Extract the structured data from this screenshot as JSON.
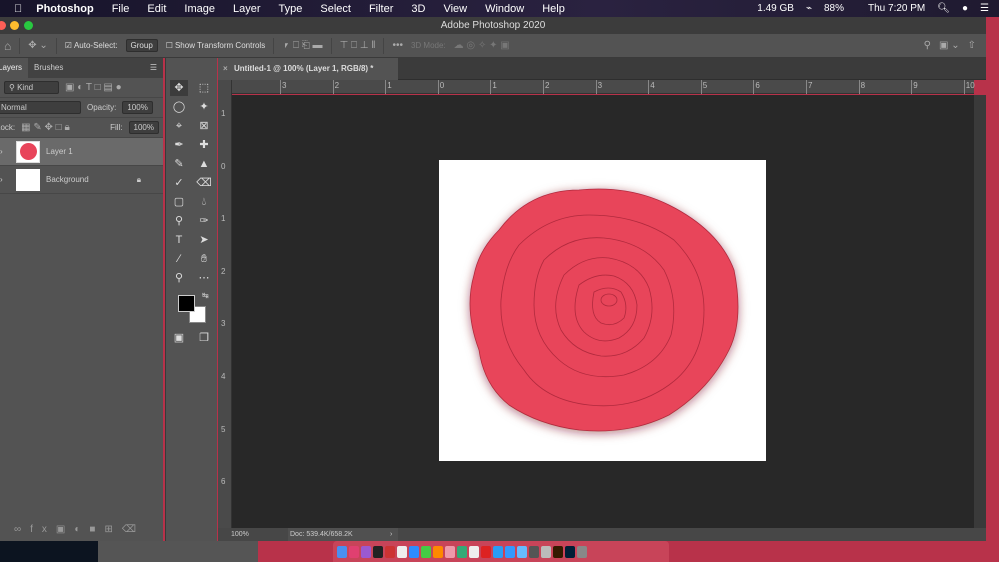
{
  "menubar": {
    "app": "Photoshop",
    "items": [
      "File",
      "Edit",
      "Image",
      "Layer",
      "Type",
      "Select",
      "Filter",
      "3D",
      "View",
      "Window",
      "Help"
    ],
    "status": {
      "memory": "1.49 GB",
      "battery": "88%",
      "clock": "Thu 7:20 PM"
    }
  },
  "window": {
    "title": "Adobe Photoshop 2020"
  },
  "options": {
    "auto_select_label": "Auto-Select:",
    "auto_select_checked": true,
    "group_value": "Group",
    "show_transform_label": "Show Transform Controls",
    "show_transform_checked": false,
    "mode_3d_label": "3D Mode:"
  },
  "layers_panel": {
    "tabs": [
      "Layers",
      "Brushes"
    ],
    "filter_kind": "Kind",
    "blend_mode": "Normal",
    "opacity_label": "Opacity:",
    "opacity_value": "100%",
    "lock_label": "Lock:",
    "fill_label": "Fill:",
    "fill_value": "100%",
    "layers": [
      {
        "name": "Layer 1",
        "selected": true
      },
      {
        "name": "Background",
        "locked": true
      }
    ]
  },
  "document": {
    "tab_title": "Untitled-1 @ 100% (Layer 1, RGB/8) *",
    "zoom": "100%",
    "doc_info": "Doc: 539.4K/658.2K"
  },
  "rulers": {
    "horizontal": [
      "3",
      "2",
      "1",
      "0",
      "1",
      "2",
      "3",
      "4",
      "5",
      "6",
      "7",
      "8",
      "9",
      "10"
    ],
    "vertical": [
      "1",
      "0",
      "1",
      "2",
      "3",
      "4",
      "5",
      "6"
    ]
  },
  "colors": {
    "foreground": "#000000",
    "background": "#ffffff",
    "rose": "#e8445a"
  }
}
